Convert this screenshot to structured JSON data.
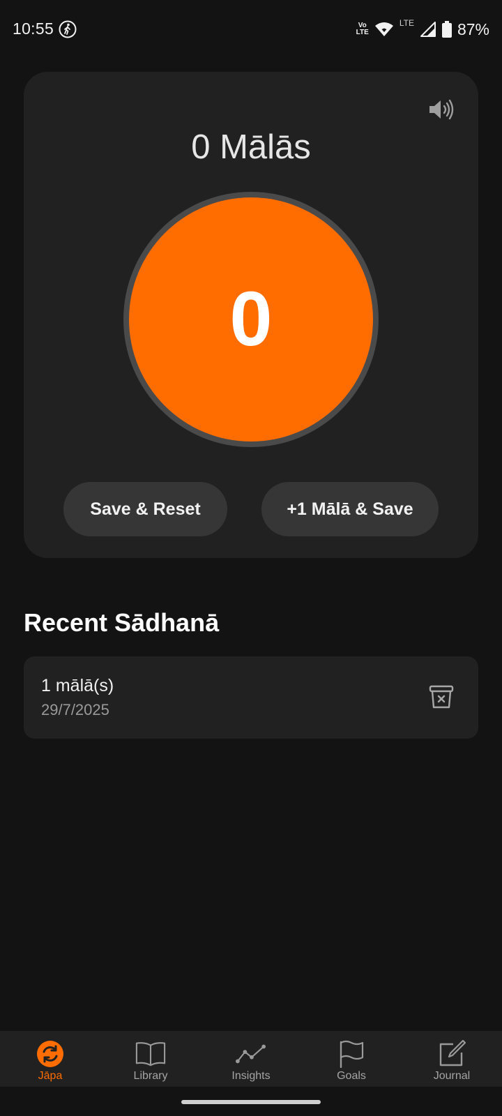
{
  "status_bar": {
    "time": "10:55",
    "network_top": "Vo",
    "network_bottom": "LTE",
    "lte_label": "LTE",
    "battery": "87%",
    "icons": [
      "walking-icon",
      "volte-icon",
      "wifi-icon",
      "signal-icon",
      "battery-icon"
    ]
  },
  "counter": {
    "malas_label": "0 Mālās",
    "count": "0",
    "save_reset_label": "Save & Reset",
    "plus_one_label": "+1 Mālā & Save",
    "sound_icon": "volume-icon",
    "accent_color": "#ff6d00"
  },
  "recent": {
    "title": "Recent Sādhanā",
    "items": [
      {
        "count_label": "1 mālā(s)",
        "date": "29/7/2025",
        "action_icon": "delete-icon"
      }
    ]
  },
  "nav": {
    "items": [
      {
        "label": "Jāpa",
        "icon": "japa-icon",
        "active": true
      },
      {
        "label": "Library",
        "icon": "book-icon",
        "active": false
      },
      {
        "label": "Insights",
        "icon": "chart-line-icon",
        "active": false
      },
      {
        "label": "Goals",
        "icon": "flag-icon",
        "active": false
      },
      {
        "label": "Journal",
        "icon": "edit-icon",
        "active": false
      }
    ]
  }
}
